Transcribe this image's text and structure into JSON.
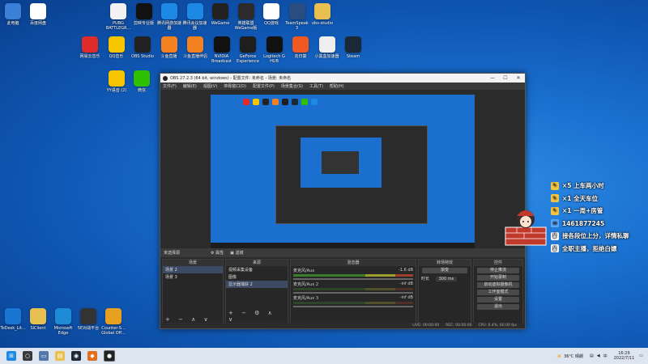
{
  "desktop": {
    "icons_row0": [
      {
        "label": "此电脑",
        "icon": "computer-icon",
        "color": "#3b7fd6"
      },
      {
        "label": "百度网盘",
        "icon": "baidu-netdisk-icon",
        "color": "#ffffff"
      },
      {
        "label": "PUBG\nBATTLEGR...",
        "icon": "pubg-icon",
        "color": "#f2f2f2"
      },
      {
        "label": "剪映专业版",
        "icon": "capcut-icon",
        "color": "#111111"
      },
      {
        "label": "腾讯网游加速\n器",
        "icon": "tencent-accel-icon",
        "color": "#1e88e5"
      },
      {
        "label": "腾讯会议加速\n器",
        "icon": "tencent-meet-icon",
        "color": "#1e88e5"
      },
      {
        "label": "WeGame",
        "icon": "wegame-icon",
        "color": "#222222"
      },
      {
        "label": "英雄联盟\nWeGame版",
        "icon": "lol-icon",
        "color": "#2b2b2b"
      },
      {
        "label": "QQ游戏",
        "icon": "qqgame-icon",
        "color": "#ffffff"
      },
      {
        "label": "TeamSpeak\n3",
        "icon": "teamspeak-icon",
        "color": "#2a4d80"
      },
      {
        "label": "obs-studio",
        "icon": "folder-icon",
        "color": "#e8c050"
      }
    ],
    "icons_row1": [
      {
        "label": "网易云音乐",
        "icon": "netease-music-icon",
        "color": "#e02b2b"
      },
      {
        "label": "QQ音乐",
        "icon": "qqmusic-icon",
        "color": "#f7c400"
      },
      {
        "label": "OBS Studio",
        "icon": "obs-icon",
        "color": "#222222"
      },
      {
        "label": "斗鱼直播",
        "icon": "douyu-icon",
        "color": "#f58220"
      },
      {
        "label": "斗鱼直播伴侣",
        "icon": "douyu-companion-icon",
        "color": "#f58220"
      },
      {
        "label": "NVIDIA\nBroadcast",
        "icon": "nvidia-broadcast-icon",
        "color": "#111111"
      },
      {
        "label": "GeForce\nExperience",
        "icon": "geforce-icon",
        "color": "#1e1e1e"
      },
      {
        "label": "Logitech G\nHUB",
        "icon": "logitech-icon",
        "color": "#111111"
      },
      {
        "label": "向日葵",
        "icon": "sunflower-icon",
        "color": "#f05a22"
      },
      {
        "label": "小黑盒加速器",
        "icon": "xiaoheihe-icon",
        "color": "#eeeeee"
      },
      {
        "label": "Steam",
        "icon": "steam-icon",
        "color": "#1b2838"
      }
    ],
    "icons_row2": [
      {
        "label": "YY语音 (2)",
        "icon": "yy-icon",
        "color": "#f7c400"
      },
      {
        "label": "微信",
        "icon": "wechat-icon",
        "color": "#2dc100"
      }
    ],
    "icons_bottom": [
      {
        "label": "ToDesk_Lit...",
        "icon": "todesk-icon",
        "color": "#1976d2"
      },
      {
        "label": "SlClient",
        "icon": "folder-icon",
        "color": "#e8c050"
      },
      {
        "label": "Microsoft\nEdge",
        "icon": "edge-icon",
        "color": "#1e8bd6"
      },
      {
        "label": "5E对战平台",
        "icon": "5e-icon",
        "color": "#333333"
      },
      {
        "label": "Counter-S...\nGlobal Off...",
        "icon": "csgo-icon",
        "color": "#e8a020"
      }
    ]
  },
  "obs": {
    "title": "OBS 27.2.3 (64 bit, windows) - 配置文件: 未命名 - 场景: 未命名",
    "menu": [
      "文件(F)",
      "编辑(E)",
      "视图(V)",
      "停靠窗口(D)",
      "配置文件(P)",
      "场景集合(S)",
      "工具(T)",
      "帮助(H)"
    ],
    "no_source": "未选择源",
    "props_btn": "属性",
    "filters_btn": "滤镜",
    "panels": {
      "scenes": {
        "header": "场景",
        "items": [
          "场景 2",
          "场景 3"
        ]
      },
      "sources": {
        "header": "来源",
        "items": [
          "视频采集设备",
          "图像",
          "显示器捕获 2"
        ]
      },
      "mixer": {
        "header": "混音器",
        "channels": [
          {
            "name": "麦克风/Aux",
            "db": "-1.6 dB"
          },
          {
            "name": "麦克风/Aux 2",
            "db": "-inf dB"
          },
          {
            "name": "麦克风/Aux 3",
            "db": "-inf dB"
          }
        ]
      },
      "transitions": {
        "header": "转场特效",
        "type": "渐变",
        "duration_label": "时长",
        "duration": "300 ms"
      },
      "controls": {
        "header": "控件",
        "buttons": [
          "停止推流",
          "开始录制",
          "启动虚拟摄像机",
          "工作室模式",
          "设置",
          "退出"
        ]
      }
    },
    "status": {
      "live": "LIVE: 00:00:00",
      "rec": "REC: 00:00:00",
      "cpu": "CPU: 6.4%, 60.00 fps"
    }
  },
  "overlay_notes": [
    {
      "text": "×5 上车两小时",
      "icon": "ticket-icon",
      "color": "#f5c542"
    },
    {
      "text": "×1 全天车位",
      "icon": "ticket-icon",
      "color": "#f5c542"
    },
    {
      "text": "×1 一周+房管",
      "icon": "ticket-icon",
      "color": "#f5c542"
    },
    {
      "text": "1461877245",
      "icon": "qq-group-icon",
      "color": "#5aa9ff"
    },
    {
      "text": "接各段位上分，详情私聊",
      "icon": "bunny-icon",
      "color": "#ffffff"
    },
    {
      "text": "全职主播，拒绝白嫖",
      "icon": "bunny-icon",
      "color": "#ffffff"
    }
  ],
  "taskbar": {
    "weather": "36°C 晴朗",
    "time": "16:29",
    "date": "2022/7/11"
  }
}
